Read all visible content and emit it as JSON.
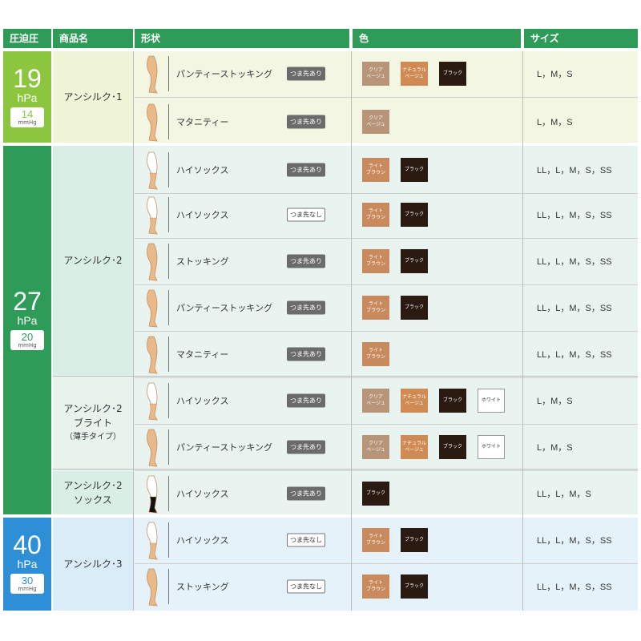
{
  "header": {
    "pressure": "圧迫圧",
    "product": "商品名",
    "shape": "形状",
    "color": "色",
    "size": "サイズ"
  },
  "tags": {
    "with_toe": "つま先あり",
    "no_toe": "つま先なし"
  },
  "bands": [
    {
      "hpa": "19",
      "unit": "hPa",
      "mmhg": "14",
      "mmhg_unit": "mmHg",
      "color": "#8cc63f",
      "bg": "#f4f6e4"
    },
    {
      "hpa": "27",
      "unit": "hPa",
      "mmhg": "20",
      "mmhg_unit": "mmHg",
      "color": "#2f9b59",
      "bg": "#e9f4f0"
    },
    {
      "hpa": "40",
      "unit": "hPa",
      "mmhg": "30",
      "mmhg_unit": "mmHg",
      "color": "#2f8fd6",
      "bg": "#e6f2fa"
    }
  ],
  "swatches": {
    "clear_beige": {
      "label": "クリア\nベージュ",
      "color": "#b89478"
    },
    "natural_beige": {
      "label": "ナチュラル\nベージュ",
      "color": "#d08a53"
    },
    "light_brown": {
      "label": "ライト\nブラウン",
      "color": "#c98a5e"
    },
    "black": {
      "label": "ブラック",
      "color": "#2b1a12"
    },
    "white": {
      "label": "ホワイト",
      "color": "#ffffff"
    }
  },
  "products": [
    {
      "name": "アンシルク･1",
      "sub": ""
    },
    {
      "name": "アンシルク･2",
      "sub": ""
    },
    {
      "name": "アンシルク･2\nブライト",
      "sub": "（薄手タイプ）"
    },
    {
      "name": "アンシルク･2\nソックス",
      "sub": ""
    },
    {
      "name": "アンシルク･3",
      "sub": ""
    }
  ],
  "rows": [
    {
      "name": "パンティーストッキング",
      "toe": "with",
      "colors": [
        "clear_beige",
        "natural_beige",
        "black"
      ],
      "size": "L，M，S",
      "leg": "pantyhose-leg-icon"
    },
    {
      "name": "マタニティー",
      "toe": "with",
      "colors": [
        "clear_beige"
      ],
      "size": "L，M，S",
      "leg": "maternity-leg-icon"
    },
    {
      "name": "ハイソックス",
      "toe": "with",
      "colors": [
        "light_brown",
        "black"
      ],
      "size": "LL，L，M，S，SS",
      "leg": "high-socks-leg-icon"
    },
    {
      "name": "ハイソックス",
      "toe": "none",
      "colors": [
        "light_brown",
        "black"
      ],
      "size": "LL，L，M，S，SS",
      "leg": "high-socks-leg-icon"
    },
    {
      "name": "ストッキング",
      "toe": "with",
      "colors": [
        "light_brown",
        "black"
      ],
      "size": "LL，L，M，S，SS",
      "leg": "stocking-leg-icon"
    },
    {
      "name": "パンティーストッキング",
      "toe": "with",
      "colors": [
        "light_brown",
        "black"
      ],
      "size": "LL，L，M，S，SS",
      "leg": "pantyhose-leg-icon"
    },
    {
      "name": "マタニティー",
      "toe": "with",
      "colors": [
        "light_brown"
      ],
      "size": "LL，L，M，S，SS",
      "leg": "maternity-leg-icon"
    },
    {
      "name": "ハイソックス",
      "toe": "with",
      "colors": [
        "clear_beige",
        "natural_beige",
        "black",
        "white"
      ],
      "size": "L，M，S",
      "leg": "high-socks-leg-icon"
    },
    {
      "name": "パンティーストッキング",
      "toe": "with",
      "colors": [
        "clear_beige",
        "natural_beige",
        "black",
        "white"
      ],
      "size": "L，M，S",
      "leg": "pantyhose-leg-icon"
    },
    {
      "name": "ハイソックス",
      "toe": "with",
      "colors": [
        "black"
      ],
      "size": "LL，L，M，S",
      "leg": "black-socks-leg-icon"
    },
    {
      "name": "ハイソックス",
      "toe": "none",
      "colors": [
        "light_brown",
        "black"
      ],
      "size": "LL，L，M，S，SS",
      "leg": "high-socks-leg-icon"
    },
    {
      "name": "ストッキング",
      "toe": "none",
      "colors": [
        "light_brown",
        "black"
      ],
      "size": "LL，L，M，S，SS",
      "leg": "stocking-leg-icon"
    }
  ]
}
